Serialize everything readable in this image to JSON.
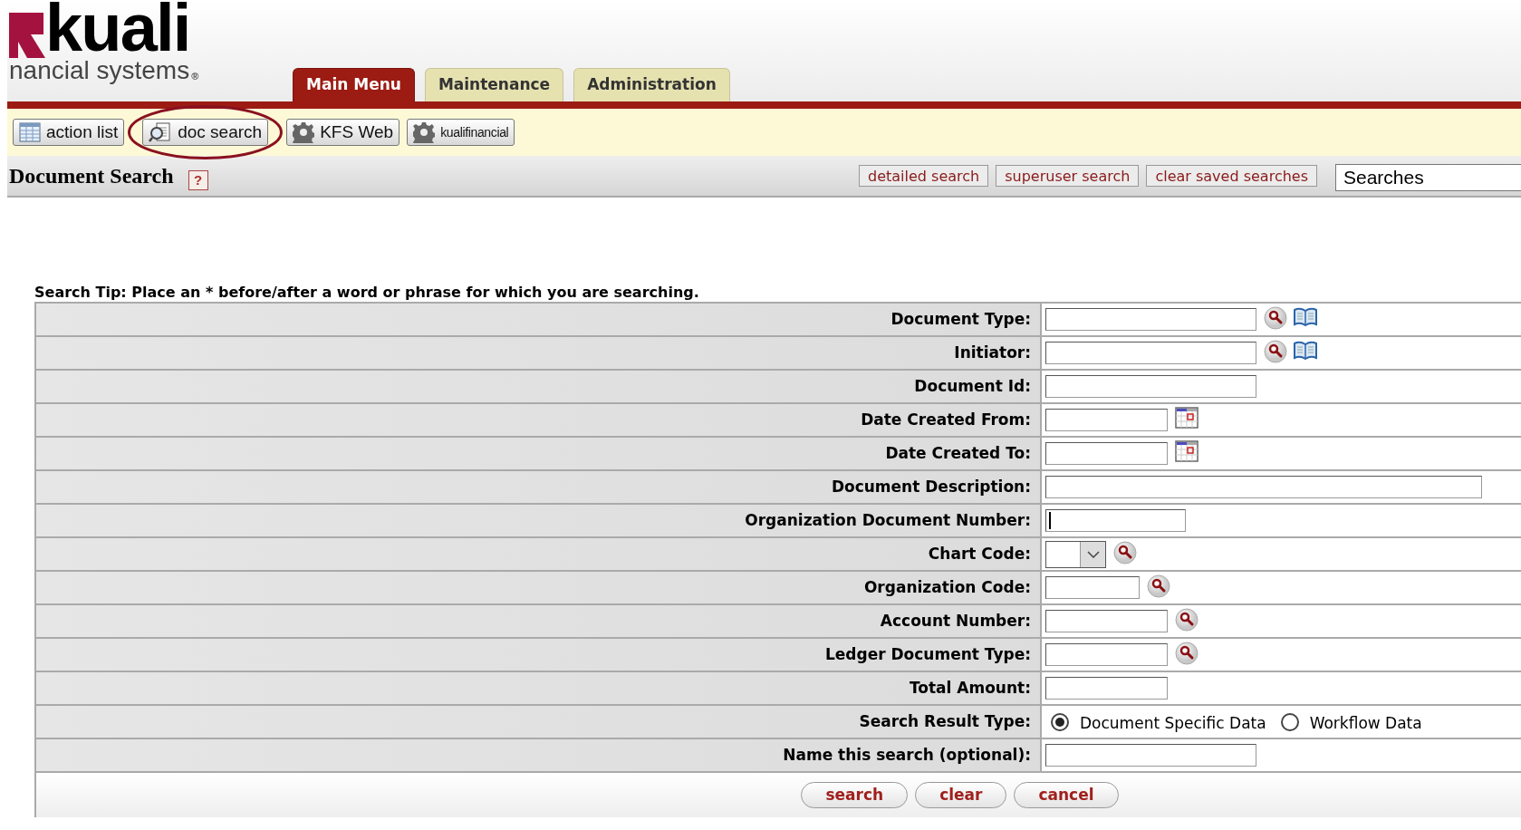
{
  "logo": {
    "name": "kuali",
    "subtitle": "nancial systems",
    "mark": "®"
  },
  "tabs": [
    {
      "label": "Main Menu",
      "selected": true
    },
    {
      "label": "Maintenance",
      "selected": false
    },
    {
      "label": "Administration",
      "selected": false
    }
  ],
  "toolbar": [
    {
      "label": "action list",
      "kind": "list"
    },
    {
      "label": "doc search",
      "kind": "search",
      "circled": true
    },
    {
      "label": "KFS Web",
      "kind": "gear"
    },
    {
      "label": "kualifinancial",
      "kind": "gear_small"
    }
  ],
  "title": "Document Search",
  "help": "?",
  "search_buttons": [
    "detailed search",
    "superuser search",
    "clear saved searches"
  ],
  "saved_searches": {
    "value": "Searches"
  },
  "tip": "Search Tip: Place an * before/after a word or phrase for which you are searching.",
  "rows": [
    {
      "label": "Document Type:",
      "kind": "text",
      "lookup": true,
      "directory": true
    },
    {
      "label": "Initiator:",
      "kind": "text",
      "lookup": true,
      "directory": true
    },
    {
      "label": "Document Id:",
      "kind": "text"
    },
    {
      "label": "Date Created From:",
      "kind": "date"
    },
    {
      "label": "Date Created To:",
      "kind": "date"
    },
    {
      "label": "Document Description:",
      "kind": "text"
    },
    {
      "label": "Organization Document Number:",
      "kind": "text",
      "focused": true
    },
    {
      "label": "Chart Code:",
      "kind": "select",
      "lookup": true
    },
    {
      "label": "Organization Code:",
      "kind": "text",
      "lookup": true
    },
    {
      "label": "Account Number:",
      "kind": "text",
      "lookup": true
    },
    {
      "label": "Ledger Document Type:",
      "kind": "text",
      "lookup": true
    },
    {
      "label": "Total Amount:",
      "kind": "text"
    },
    {
      "label": "Search Result Type:",
      "kind": "radio",
      "options": [
        {
          "label": "Document Specific Data",
          "selected": true
        },
        {
          "label": "Workflow Data",
          "selected": false
        }
      ]
    },
    {
      "label": "Name this search (optional):",
      "kind": "text"
    }
  ],
  "actions": [
    "search",
    "clear",
    "cancel"
  ]
}
